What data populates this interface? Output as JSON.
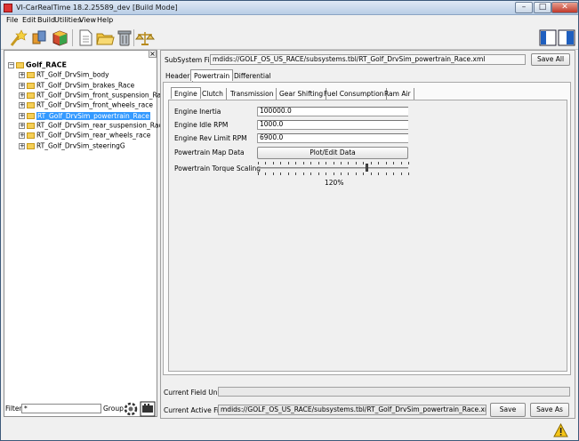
{
  "window": {
    "title": "VI-CarRealTime 18.2.25589_dev [Build Mode]",
    "controls": {
      "minimize": "–",
      "maximize": "□",
      "close": "✕"
    }
  },
  "menu": [
    "File",
    "Edit",
    "Build",
    "Utilities",
    "View",
    "Help"
  ],
  "toolbar": {
    "icons": [
      "wizard-icon",
      "component-icon",
      "cube-icon",
      "new-file-icon",
      "open-folder-icon",
      "delete-icon",
      "balance-icon"
    ],
    "right_icons": [
      "layout-left-icon",
      "layout-right-icon"
    ]
  },
  "tree": {
    "root": "Golf_RACE",
    "items": [
      "RT_Golf_DrvSim_body",
      "RT_Golf_DrvSim_brakes_Race",
      "RT_Golf_DrvSim_front_suspension_Race",
      "RT_Golf_DrvSim_front_wheels_race",
      "RT_Golf_DrvSim_powertrain_Race",
      "RT_Golf_DrvSim_rear_suspension_Race",
      "RT_Golf_DrvSim_rear_wheels_race",
      "RT_Golf_DrvSim_steeringG"
    ],
    "selected_index": 4
  },
  "filter": {
    "label": "Filter",
    "value": "*",
    "group_label": "Group"
  },
  "subsystem": {
    "label": "SubSystem File",
    "path": "mdids://GOLF_OS_US_RACE/subsystems.tbl/RT_Golf_DrvSim_powertrain_Race.xml",
    "save_all": "Save All"
  },
  "tabs": [
    "Header",
    "Powertrain",
    "Differential"
  ],
  "active_tab": "Powertrain",
  "subtabs": [
    "Engine",
    "Clutch",
    "Transmission",
    "Gear Shifting",
    "Fuel Consumption",
    "Ram Air"
  ],
  "active_subtab": "Engine",
  "engine": {
    "inertia_label": "Engine Inertia",
    "inertia_value": "100000.0",
    "idle_label": "Engine Idle RPM",
    "idle_value": "1000.0",
    "rev_limit_label": "Engine Rev Limit RPM",
    "rev_limit_value": "6900.0",
    "map_label": "Powertrain Map Data",
    "map_button": "Plot/Edit Data",
    "torque_label": "Powertrain Torque Scaling",
    "torque_value_text": "120%",
    "torque_fraction": 0.72
  },
  "bottom": {
    "current_field_label": "Current Field Unit",
    "current_field_value": "",
    "active_file_label": "Current Active File",
    "active_file_path": "mdids://GOLF_OS_US_RACE/subsystems.tbl/RT_Golf_DrvSim_powertrain_Race.xml",
    "save": "Save",
    "save_as": "Save As"
  }
}
